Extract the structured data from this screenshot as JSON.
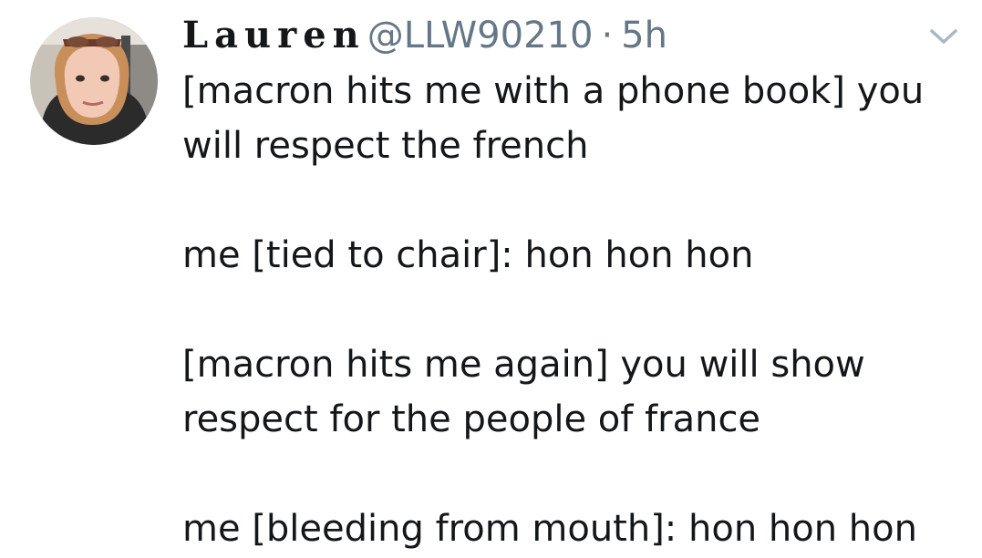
{
  "tweet": {
    "author": {
      "display_name": "Lauren",
      "handle": "@LLW90210",
      "avatar_icon": "profile-photo"
    },
    "separator": "·",
    "timestamp": "5h",
    "menu_icon": "chevron-down-icon",
    "body": [
      {
        "lines": [
          "[macron hits me with a phone book] you",
          "will respect the french"
        ]
      },
      {
        "lines": [
          "me [tied to chair]: hon hon hon"
        ]
      },
      {
        "lines": [
          "[macron hits me again] you will show",
          "respect for the people of france"
        ]
      },
      {
        "lines": [
          "me [bleeding from mouth]: hon hon hon"
        ]
      }
    ]
  },
  "colors": {
    "text": "#14171a",
    "secondary": "#657786",
    "chevron": "#aab8c2"
  }
}
